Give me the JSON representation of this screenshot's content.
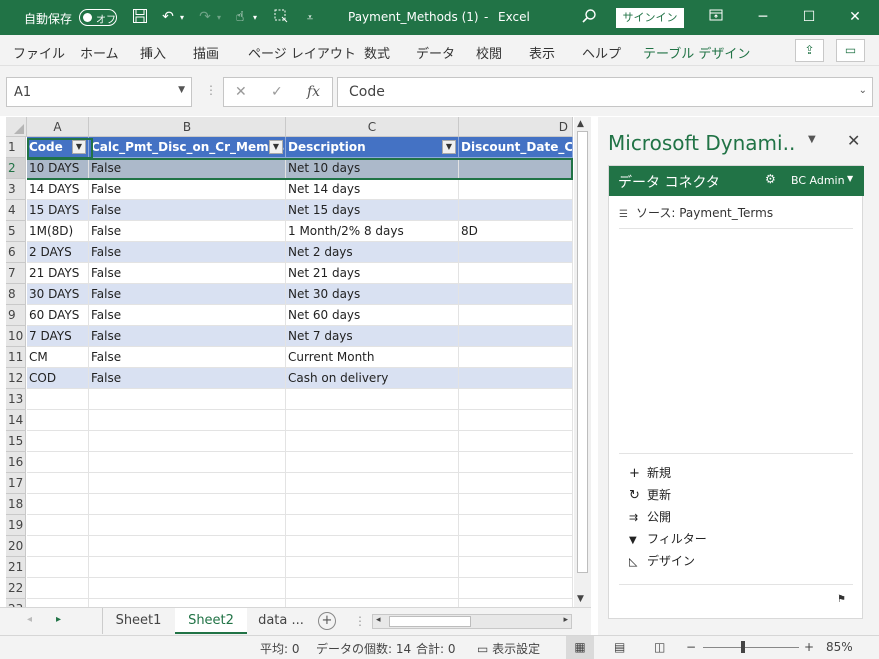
{
  "titlebar": {
    "autosave_label": "自動保存",
    "autosave_state": "オフ",
    "doc_title": "Payment_Methods (1)",
    "separator": "-",
    "app_name": "Excel",
    "signin_label": "サインイン"
  },
  "ribbon": {
    "tabs": [
      "ファイル",
      "ホーム",
      "挿入",
      "描画",
      "ページ レイアウト",
      "数式",
      "データ",
      "校閲",
      "表示",
      "ヘルプ",
      "テーブル デザイン"
    ],
    "active_tab": "テーブル デザイン"
  },
  "formula_bar": {
    "name_box": "A1",
    "fx_label": "fx",
    "formula_value": "Code"
  },
  "grid": {
    "column_headers": [
      "A",
      "B",
      "C",
      "D"
    ],
    "table_headers": [
      "Code",
      "Calc_Pmt_Disc_on_Cr_Memos",
      "Description",
      "Discount_Date_Cal"
    ],
    "rows": [
      [
        "10 DAYS",
        "False",
        "Net 10 days",
        ""
      ],
      [
        "14 DAYS",
        "False",
        "Net 14 days",
        ""
      ],
      [
        "15 DAYS",
        "False",
        "Net 15 days",
        ""
      ],
      [
        "1M(8D)",
        "False",
        "1 Month/2% 8 days",
        "8D"
      ],
      [
        "2 DAYS",
        "False",
        "Net 2 days",
        ""
      ],
      [
        "21 DAYS",
        "False",
        "Net 21 days",
        ""
      ],
      [
        "30 DAYS",
        "False",
        "Net 30 days",
        ""
      ],
      [
        "60 DAYS",
        "False",
        "Net 60 days",
        ""
      ],
      [
        "7 DAYS",
        "False",
        "Net 7 days",
        ""
      ],
      [
        "CM",
        "False",
        "Current Month",
        ""
      ],
      [
        "COD",
        "False",
        "Cash on delivery",
        ""
      ]
    ],
    "row_numbers": [
      "1",
      "2",
      "3",
      "4",
      "5",
      "6",
      "7",
      "8",
      "9",
      "10",
      "11",
      "12",
      "13",
      "14",
      "15",
      "16",
      "17",
      "18",
      "19",
      "20",
      "21",
      "22",
      "23"
    ]
  },
  "sheets": {
    "tabs": [
      "Sheet1",
      "Sheet2",
      "data ..."
    ],
    "active": "Sheet2",
    "add_label": "+"
  },
  "pane": {
    "title": "Microsoft Dynami..",
    "header_label": "データ コネクタ",
    "user_label": "BC Admin",
    "source_label": "ソース: Payment_Terms",
    "actions": [
      {
        "icon": "plus-icon",
        "label": "新規"
      },
      {
        "icon": "refresh-icon",
        "label": "更新"
      },
      {
        "icon": "publish-icon",
        "label": "公開"
      },
      {
        "icon": "filter-icon",
        "label": "フィルター"
      },
      {
        "icon": "design-icon",
        "label": "デザイン"
      }
    ]
  },
  "status": {
    "average": "平均: 0",
    "count": "データの個数: 14",
    "sum": "合計: 0",
    "display_settings": "表示設定",
    "zoom": "85%"
  }
}
